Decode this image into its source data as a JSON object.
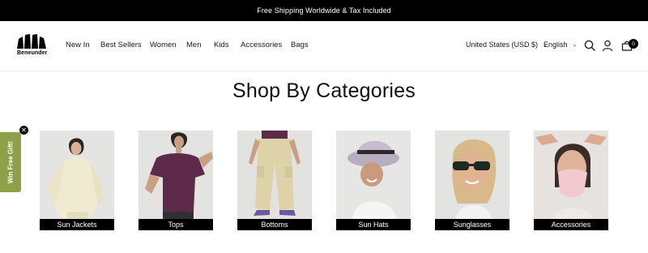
{
  "announcement": {
    "text": "Free Shipping Worldwide & Tax Included"
  },
  "header": {
    "logo_text": "Beneunder",
    "nav": [
      "New In",
      "Best Sellers",
      "Women",
      "Men",
      "Kids",
      "Accessories",
      "Bags"
    ],
    "country_selector": "United States (USD $)",
    "language_selector": "English",
    "cart_count": "0"
  },
  "main": {
    "title": "Shop By Categories",
    "categories": [
      {
        "label": "Sun Jackets"
      },
      {
        "label": "Tops"
      },
      {
        "label": "Bottoms"
      },
      {
        "label": "Sun Hats"
      },
      {
        "label": "Sunglasses"
      },
      {
        "label": "Accessories"
      }
    ]
  },
  "gift_tab": {
    "label": "Win Free Gift!",
    "close_glyph": "✕"
  },
  "colors": {
    "accent": "#8ea04a",
    "bar": "#000000"
  },
  "icons": [
    "chevron-down-icon",
    "search-icon",
    "account-icon",
    "cart-icon",
    "close-icon"
  ]
}
